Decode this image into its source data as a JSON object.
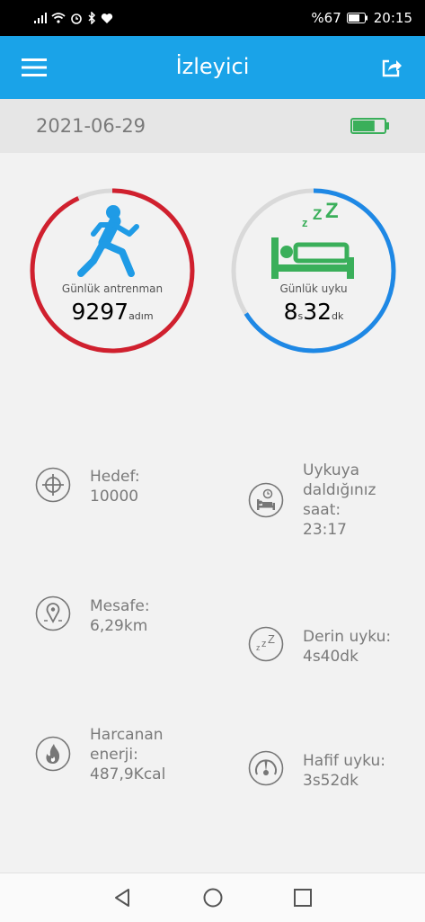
{
  "status_bar": {
    "battery_percent": "%67",
    "time": "20:15"
  },
  "app_bar": {
    "title": "İzleyici",
    "menu_icon": "hamburger-menu-icon",
    "share_icon": "share-icon"
  },
  "date": "2021-06-29",
  "device_battery_level": 0.7,
  "colors": {
    "accent": "#1aa3e8",
    "training": "#d0202e",
    "sleep": "#1e88e5",
    "green": "#3aaf5a",
    "track": "#d9d9d9"
  },
  "training": {
    "label": "Günlük antrenman",
    "value": "9297",
    "unit": "adım",
    "progress": 0.93
  },
  "sleep": {
    "label": "Günlük uyku",
    "hours": "8",
    "hours_unit": "s",
    "minutes": "32",
    "minutes_unit": "dk",
    "progress": 0.66
  },
  "stats": {
    "target": "Hedef:\n10000",
    "sleep_time": "Uykuya\ndaldığınız\nsaat:\n23:17",
    "distance": "Mesafe:\n6,29km",
    "deep_sleep": "Derin uyku:\n4s40dk",
    "energy": "Harcanan\nenerji:\n487,9Kcal",
    "light_sleep": "Hafif uyku:\n3s52dk"
  }
}
